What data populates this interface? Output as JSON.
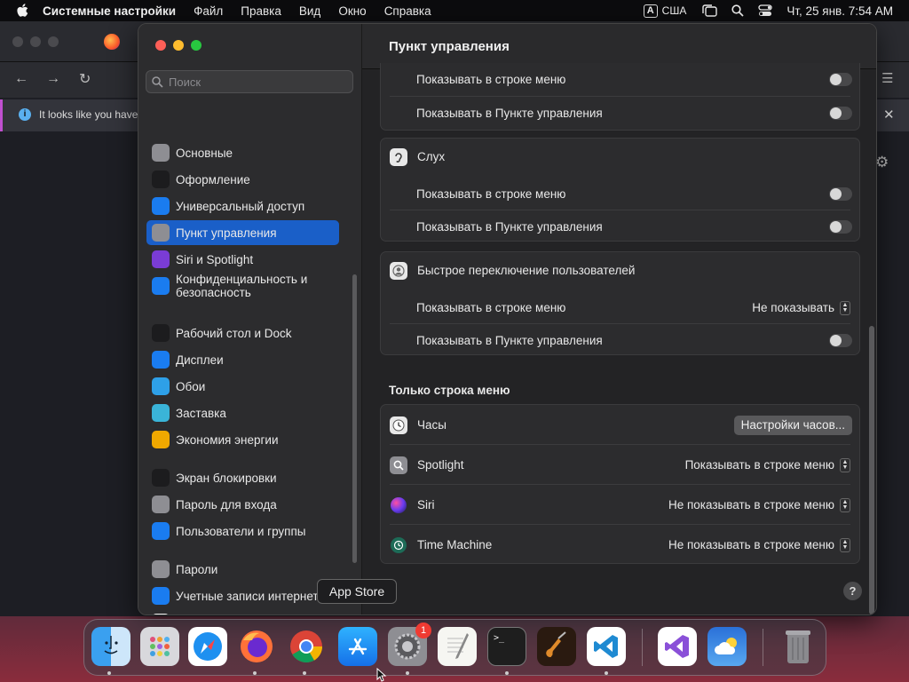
{
  "menubar": {
    "app_name": "Системные настройки",
    "items": [
      "Файл",
      "Правка",
      "Вид",
      "Окно",
      "Справка"
    ],
    "input_source_badge": "A",
    "input_source": "США",
    "datetime": "Чт, 25 янв. 7:54 AM"
  },
  "browser": {
    "info_text": "It looks like you have"
  },
  "sidebar": {
    "search_placeholder": "Поиск",
    "items": [
      {
        "label": "Основные",
        "icon": "gear-icon",
        "color": "#8e8e93"
      },
      {
        "label": "Оформление",
        "icon": "appearance-icon",
        "color": "#1c1c1e"
      },
      {
        "label": "Универсальный доступ",
        "icon": "accessibility-icon",
        "color": "#1a7cf0"
      },
      {
        "label": "Пункт управления",
        "icon": "control-center-icon",
        "color": "#8e8e93"
      },
      {
        "label": "Siri и Spotlight",
        "icon": "siri-icon",
        "color": "#7a3cd6"
      },
      {
        "label": "Конфиденциальность и безопасность",
        "icon": "hand-icon",
        "color": "#1a7cf0"
      },
      {
        "label": "Рабочий стол и Dock",
        "icon": "dock-icon",
        "color": "#1c1c1e"
      },
      {
        "label": "Дисплеи",
        "icon": "display-icon",
        "color": "#1a7cf0"
      },
      {
        "label": "Обои",
        "icon": "wallpaper-icon",
        "color": "#2ea0e8"
      },
      {
        "label": "Заставка",
        "icon": "screensaver-icon",
        "color": "#3ab4d8"
      },
      {
        "label": "Экономия энергии",
        "icon": "battery-icon",
        "color": "#f0a800"
      },
      {
        "label": "Экран блокировки",
        "icon": "lock-screen-icon",
        "color": "#1c1c1e"
      },
      {
        "label": "Пароль для входа",
        "icon": "lock-icon",
        "color": "#8e8e93"
      },
      {
        "label": "Пользователи и группы",
        "icon": "users-icon",
        "color": "#1a7cf0"
      },
      {
        "label": "Пароли",
        "icon": "key-icon",
        "color": "#8e8e93"
      },
      {
        "label": "Учетные записи интернета",
        "icon": "at-icon",
        "color": "#1a7cf0"
      },
      {
        "label": "Game Center",
        "icon": "game-center-icon",
        "color": "#e8e8e8"
      }
    ]
  },
  "main": {
    "title": "Пункт управления",
    "show_in_menubar": "Показывать в строке меню",
    "show_in_control_center": "Показывать в Пункте управления",
    "hearing": "Слух",
    "fast_user_switching": "Быстрое переключение пользователей",
    "fus_menubar_value": "Не показывать",
    "menubar_only_title": "Только строка меню",
    "clock": "Часы",
    "clock_button": "Настройки часов...",
    "spotlight": "Spotlight",
    "spotlight_value": "Показывать в строке меню",
    "siri": "Siri",
    "siri_value": "Не показывать в строке меню",
    "time_machine": "Time Machine",
    "time_machine_value": "Не показывать в строке меню",
    "help": "?"
  },
  "tooltip": "App Store",
  "dock": {
    "apps": [
      "Finder",
      "Launchpad",
      "Safari",
      "Firefox",
      "Chrome",
      "App Store",
      "Системные настройки",
      "TextEdit",
      "Terminal",
      "GarageBand",
      "Visual Studio Code",
      "Visual Studio",
      "Погода",
      "Корзина"
    ],
    "settings_badge": "1"
  }
}
